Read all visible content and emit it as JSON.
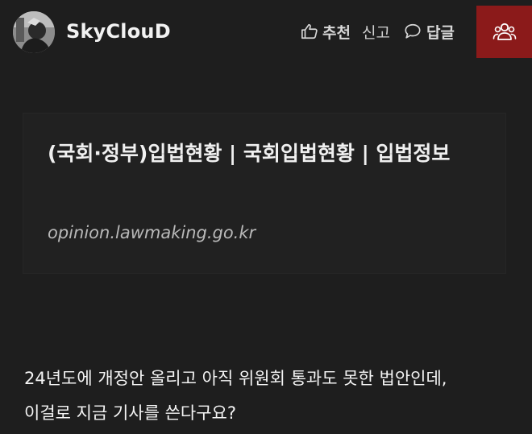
{
  "author": {
    "username": "SkyClouD",
    "avatar_icon": "avatar-photo"
  },
  "actions": {
    "recommend_label": "추천",
    "report_label": "신고",
    "reply_label": "답글",
    "recommend_icon": "thumbs-up-icon",
    "reply_icon": "speech-bubble-icon",
    "users_icon": "users-icon"
  },
  "colors": {
    "background": "#1e1e1e",
    "users_button": "#8b1a1a",
    "card_background": "#212121"
  },
  "link_card": {
    "title": "(국회·정부)입법현황 | 국회입법현황 | 입법정보",
    "url": "opinion.lawmaking.go.kr"
  },
  "post": {
    "paragraphs": [
      "24년도에 개정안 올리고 아직 위원회 통과도 못한 법안인데,",
      "이걸로 지금 기사를 쓴다구요?"
    ]
  }
}
